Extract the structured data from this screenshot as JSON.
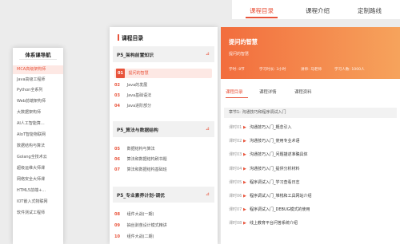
{
  "nav": {
    "tabs": [
      "课程目录",
      "课程介绍",
      "定制路线"
    ]
  },
  "sidebar": {
    "title": "体系课导航",
    "items": [
      "MCA高级架构师",
      "Java高级工程师",
      "Python全系列",
      "Web前端架构师",
      "大数据架构师",
      "AI人工智能算...",
      "AIoT智能物联网",
      "数据结构与算法",
      "Golang全技术云",
      "超级运维大师课",
      "网络安全大师课",
      "HTML5前端+...",
      "IOT嵌入式物联网",
      "软件测试工程师"
    ]
  },
  "catalog": {
    "title": "课程目录",
    "chapters": [
      {
        "title": "P5_架构前置知识",
        "lessons": [
          {
            "num": "01",
            "name": "提问的智慧",
            "active": true
          },
          {
            "num": "02",
            "name": "Java的发展",
            "active": false
          },
          {
            "num": "03",
            "name": "Java基础语法",
            "active": false
          },
          {
            "num": "04",
            "name": "Java进阶部分",
            "active": false
          }
        ]
      },
      {
        "title": "P5_算法与数据结构",
        "lessons": [
          {
            "num": "05",
            "name": "数据结构与算法",
            "active": false
          },
          {
            "num": "06",
            "name": "算法和数据结构刷书题",
            "active": false
          },
          {
            "num": "07",
            "name": "算法和数据结构基础班",
            "active": false
          }
        ]
      },
      {
        "title": "P5_专业素养计划-调优",
        "lessons": [
          {
            "num": "08",
            "name": "组件大战(一期)",
            "active": false
          },
          {
            "num": "09",
            "name": "抽丝剥茧设计模式精讲",
            "active": false
          },
          {
            "num": "10",
            "name": "组件大战(二期)",
            "active": false
          }
        ]
      }
    ]
  },
  "course": {
    "title": "提问的智慧",
    "subtitle": "提问的智慧",
    "meta": [
      "学时: 8节",
      "学习时长: 3小时",
      "讲师: 马老师",
      "学习人数: 1000人"
    ],
    "tabs": [
      "课程目录",
      "课程详情",
      "课程资料"
    ],
    "section": "章节1: 沟通技巧和程序调试入门",
    "rows": [
      {
        "label": "课时01",
        "name": "沟通技巧入门_概念引入"
      },
      {
        "label": "课时02",
        "name": "沟通技巧入门_使用专业术语"
      },
      {
        "label": "课时03",
        "name": "沟通技巧入门_问题描述准确具体"
      },
      {
        "label": "课时04",
        "name": "沟通技巧入门_提供分析材料"
      },
      {
        "label": "课时05",
        "name": "程序调试入门_学习查看日志"
      },
      {
        "label": "课时06",
        "name": "程序调试入门_堆栈和工具网站介绍"
      },
      {
        "label": "课时07",
        "name": "程序调试入门_DEBUG模式的使用"
      },
      {
        "label": "课时08",
        "name": "线上教育平台问答系统介绍"
      }
    ]
  },
  "colors": {
    "accent": "#e8533b",
    "hero_start": "#f26d3d",
    "hero_end": "#f6a35c"
  }
}
